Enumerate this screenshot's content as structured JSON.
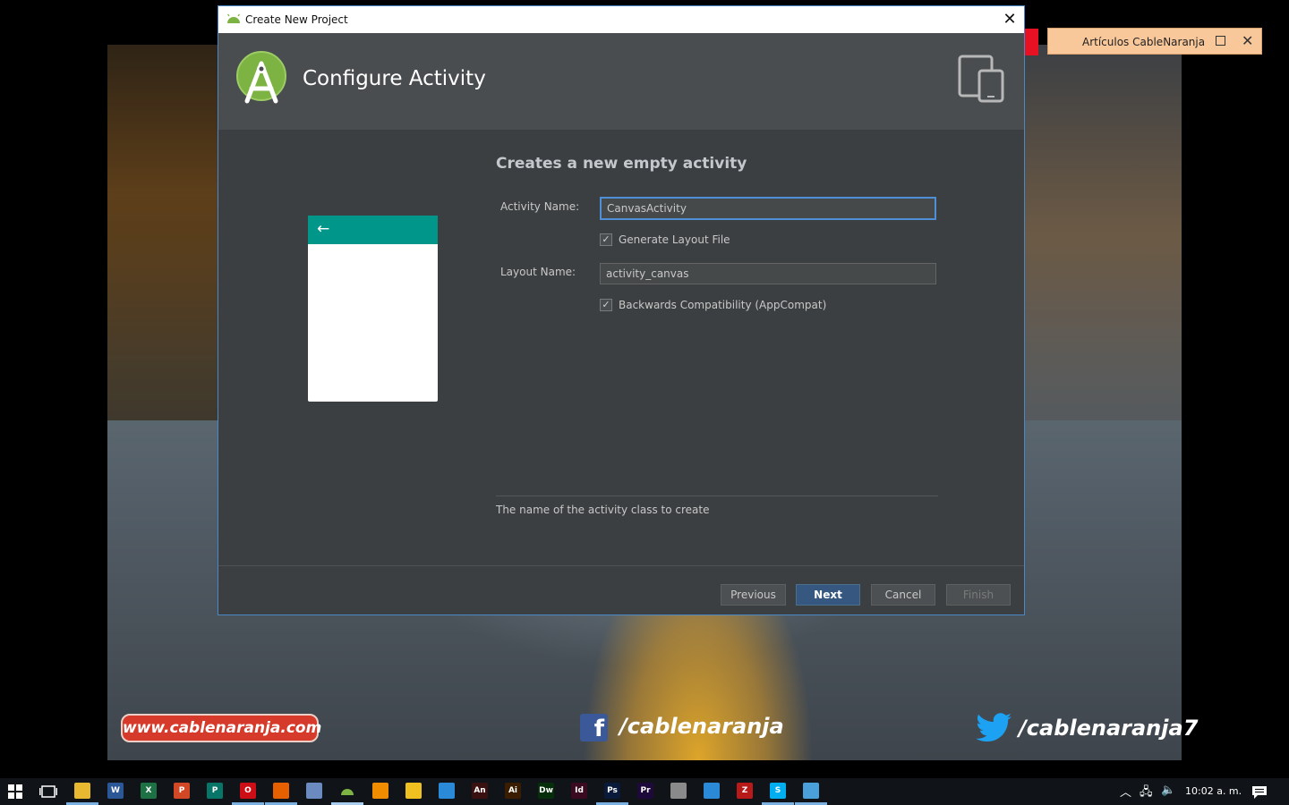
{
  "dialog": {
    "title": "Create New Project",
    "header_title": "Configure Activity",
    "form_title": "Creates a new empty activity",
    "activity_name_label": "Activity Name:",
    "activity_name_value": "CanvasActivity",
    "generate_layout_label": "Generate Layout File",
    "generate_layout_checked": true,
    "layout_name_label": "Layout Name:",
    "layout_name_value": "activity_canvas",
    "backwards_compat_label": "Backwards Compatibility (AppCompat)",
    "backwards_compat_checked": true,
    "hint": "The name of the activity class to create",
    "buttons": {
      "previous": "Previous",
      "next": "Next",
      "cancel": "Cancel",
      "finish": "Finish"
    },
    "preview_back_icon": "arrow-left-icon"
  },
  "notification": {
    "title": "Artículos CableNaranja"
  },
  "wallpaper": {
    "website": "www.cablenaranja.com",
    "facebook": "/cablenaranja",
    "twitter": "/cablenaranja7"
  },
  "taskbar": {
    "time": "10:02 a. m.",
    "apps": [
      {
        "name": "file-explorer",
        "glyph": "",
        "color": "#e8b830"
      },
      {
        "name": "word",
        "glyph": "W",
        "color": "#2b5797"
      },
      {
        "name": "excel",
        "glyph": "X",
        "color": "#1e7145"
      },
      {
        "name": "powerpoint",
        "glyph": "P",
        "color": "#d24726"
      },
      {
        "name": "publisher",
        "glyph": "P",
        "color": "#077568"
      },
      {
        "name": "opera",
        "glyph": "O",
        "color": "#cc0f16"
      },
      {
        "name": "firefox",
        "glyph": "",
        "color": "#e66000"
      },
      {
        "name": "virtualbox",
        "glyph": "",
        "color": "#6a8ac0"
      },
      {
        "name": "android-studio",
        "glyph": "",
        "color": "#7cb342"
      },
      {
        "name": "vlc",
        "glyph": "",
        "color": "#f08c00"
      },
      {
        "name": "app-a",
        "glyph": "",
        "color": "#f0c020"
      },
      {
        "name": "app-box",
        "glyph": "",
        "color": "#2a8ad8"
      },
      {
        "name": "animate",
        "glyph": "An",
        "color": "#3a1010"
      },
      {
        "name": "illustrator",
        "glyph": "Ai",
        "color": "#3a1c00"
      },
      {
        "name": "dreamweaver",
        "glyph": "Dw",
        "color": "#072e0a"
      },
      {
        "name": "indesign",
        "glyph": "Id",
        "color": "#3a0a20"
      },
      {
        "name": "photoshop",
        "glyph": "Ps",
        "color": "#0a1a3a"
      },
      {
        "name": "premiere",
        "glyph": "Pr",
        "color": "#1e0a3a"
      },
      {
        "name": "app-gray",
        "glyph": "",
        "color": "#8a8a8a"
      },
      {
        "name": "app-frame",
        "glyph": "",
        "color": "#2a8ad8"
      },
      {
        "name": "filezilla",
        "glyph": "Z",
        "color": "#b81a1a"
      },
      {
        "name": "skype",
        "glyph": "S",
        "color": "#00aff0"
      },
      {
        "name": "app-paint",
        "glyph": "",
        "color": "#4aa0d8"
      }
    ]
  },
  "colors": {
    "accent": "#365880",
    "dialog_bg": "#3c3f41",
    "header_bg": "#4a4d4f",
    "preview_toolbar": "#00968a"
  }
}
